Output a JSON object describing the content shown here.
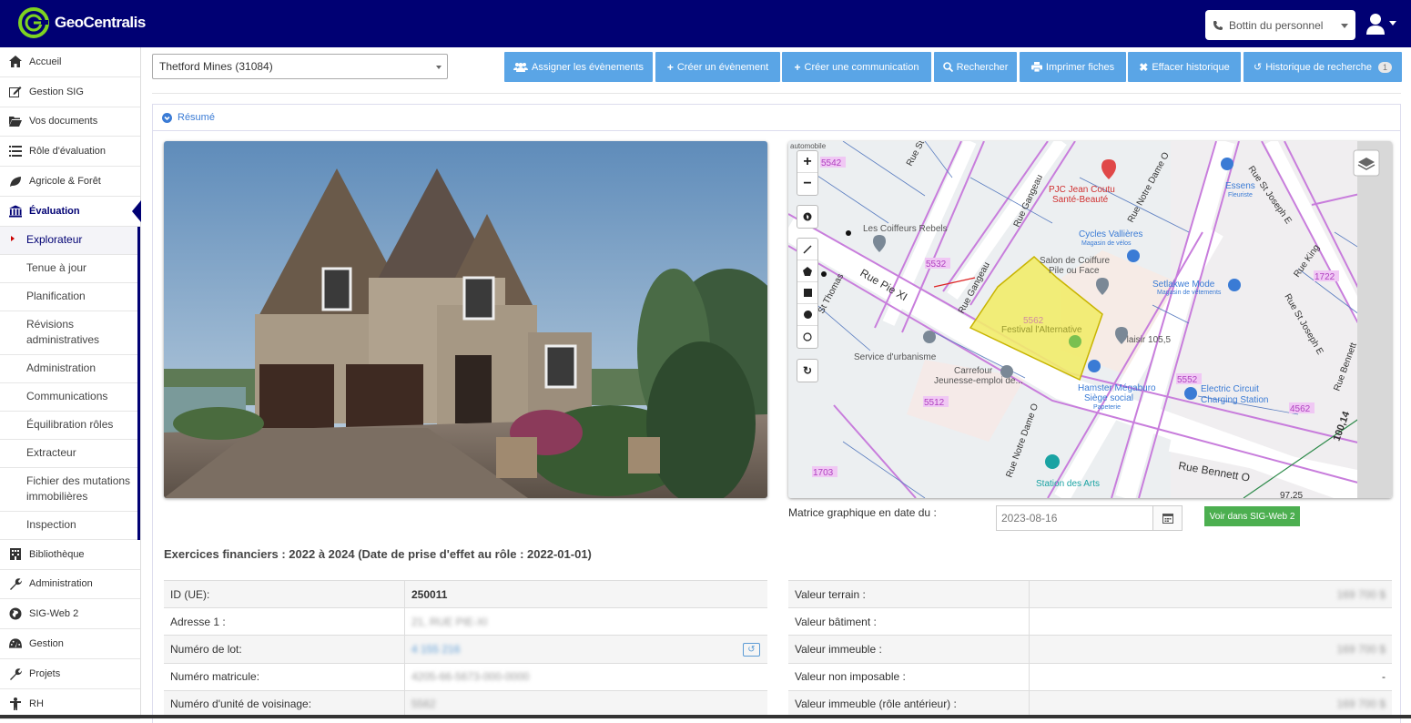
{
  "app": {
    "name": "GeoCentralis"
  },
  "header": {
    "staff_placeholder": "Bottin du personnel"
  },
  "sidebar": {
    "items": [
      {
        "label": "Accueil"
      },
      {
        "label": "Gestion SIG"
      },
      {
        "label": "Vos documents"
      },
      {
        "label": "Rôle d'évaluation"
      },
      {
        "label": "Agricole & Forêt"
      },
      {
        "label": "Évaluation"
      }
    ],
    "subitems": [
      {
        "label": "Explorateur"
      },
      {
        "label": "Tenue à jour"
      },
      {
        "label": "Planification"
      },
      {
        "label": "Révisions administratives"
      },
      {
        "label": "Administration"
      },
      {
        "label": "Communications"
      },
      {
        "label": "Équilibration rôles"
      },
      {
        "label": "Extracteur"
      },
      {
        "label": "Fichier des mutations immobilières"
      },
      {
        "label": "Inspection"
      }
    ],
    "items2": [
      {
        "label": "Bibliothèque"
      },
      {
        "label": "Administration"
      },
      {
        "label": "SIG-Web 2"
      },
      {
        "label": "Gestion"
      },
      {
        "label": "Projets"
      },
      {
        "label": "RH"
      }
    ]
  },
  "toolbar": {
    "municipality": "Thetford Mines (31084)",
    "buttons": [
      {
        "label": "Assigner les évènements"
      },
      {
        "label": "Créer un évènement"
      },
      {
        "label": "Créer une communication"
      },
      {
        "label": "Rechercher"
      },
      {
        "label": "Imprimer fiches"
      },
      {
        "label": "Effacer historique"
      },
      {
        "label": "Historique de recherche",
        "badge": "1"
      }
    ]
  },
  "summary": {
    "label": "Résumé"
  },
  "map": {
    "labels": {
      "automobile": "automobile",
      "p5542": "5542",
      "coiffeurs": "Les Coiffeurs Rebels",
      "jeancoutu1": "PJC Jean Coutu",
      "jeancoutu2": "Santé-Beauté",
      "cycles": "Cycles Vallières",
      "cycles_sub": "Magasin de vélos",
      "salon1": "Salon de Coiffure",
      "salon2": "Pile ou Face",
      "setlakwe": "Setlakwe Mode",
      "setlakwe_sub": "Magasin de vêtements",
      "essens": "Essens",
      "essens_sub": "Fleuriste",
      "p5532": "5532",
      "p5562": "5562",
      "festival": "Festival l'Alternative",
      "plaisir": "Plaisir 105,5",
      "urbanisme": "Service d'urbanisme",
      "carrefour1": "Carrefour",
      "carrefour2": "Jeunesse-emploi de...",
      "p5512": "5512",
      "hamster1": "Hamster Mégaburo",
      "hamster2": "Siège social",
      "hamster_sub": "Papeterie",
      "p5552": "5552",
      "electric1": "Electric Circuit",
      "electric2": "Charging Station",
      "p4562": "4562",
      "p1722": "1722",
      "p1703": "1703",
      "station": "Station des Arts",
      "bennett": "Rue Bennett O",
      "bennett2": "Rue Bennett",
      "piexi": "Rue Pie XI",
      "gangeau1": "Rue Gangeau",
      "gangeau2": "Rue Gangeau",
      "notredame1": "Rue Notre Dame O",
      "notredame2": "Rue Notre Dame O",
      "stjoseph1": "Rue St Joseph E",
      "stjoseph2": "Rue St Joseph E",
      "king": "Rue King",
      "ruest": "Rue St",
      "stthomas": "St Thomas",
      "val100": "100,14",
      "val97": "97,25"
    }
  },
  "matrix": {
    "label": "Matrice graphique en date du :",
    "date": "2023-08-16",
    "sig_button": "Voir dans SIG-Web 2"
  },
  "fiscal": {
    "title": "Exercices financiers : 2022 à 2024 (Date de prise d'effet au rôle : 2022-01-01)"
  },
  "left_table": [
    {
      "key": "ID (UE):",
      "value": "250011"
    },
    {
      "key": "Adresse 1 :",
      "value": "21, RUE PIE-XI"
    },
    {
      "key": "Numéro de lot:",
      "value": "4 155 216"
    },
    {
      "key": "Numéro matricule:",
      "value": "4205-66-5673-000-0000"
    },
    {
      "key": "Numéro d'unité de voisinage:",
      "value": "5562"
    }
  ],
  "right_table": [
    {
      "key": "Valeur terrain :",
      "value": "169 700 $"
    },
    {
      "key": "Valeur bâtiment :",
      "value": ""
    },
    {
      "key": "Valeur immeuble :",
      "value": "169 700 $"
    },
    {
      "key": "Valeur non imposable :",
      "value": "-"
    },
    {
      "key": "Valeur immeuble (rôle antérieur) :",
      "value": "169 700 $"
    }
  ],
  "colors": {
    "topbar": "#000073",
    "button": "#5aa5e6",
    "accent": "#000073",
    "sig_button": "#4caf50"
  }
}
